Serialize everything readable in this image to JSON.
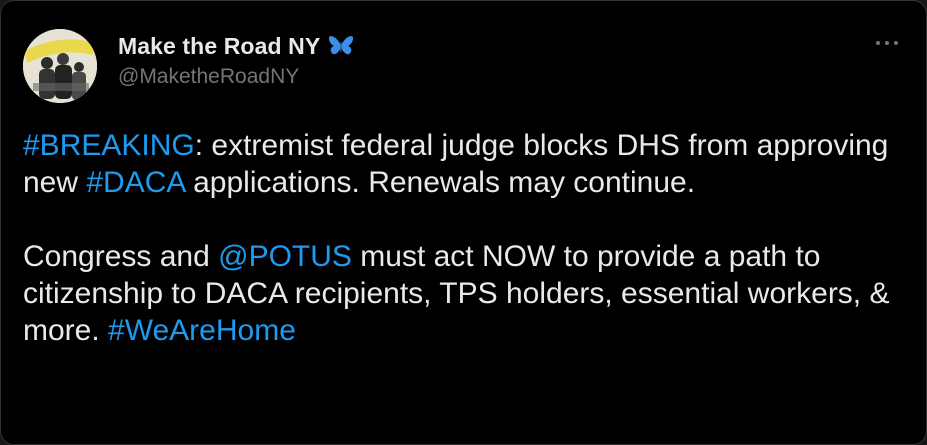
{
  "author": {
    "display_name": "Make the Road NY",
    "badge_icon": "butterfly-icon",
    "handle": "@MaketheRoadNY",
    "avatar_text": "MAKE THE ROAD NEW YORK"
  },
  "menu": {
    "icon": "more-options-icon"
  },
  "tweet": {
    "p1": {
      "hashtag_breaking": "#BREAKING",
      "t1": ": extremist federal judge blocks DHS from approving new ",
      "hashtag_daca": "#DACA",
      "t2": " applications. Renewals may continue."
    },
    "p2": {
      "t1": "Congress and ",
      "mention_potus": "@POTUS",
      "t2": " must act NOW to provide a path to citizenship to DACA recipients, TPS holders, essential workers, & more. ",
      "hashtag_wearehome": "#WeAreHome"
    }
  },
  "colors": {
    "background": "#000000",
    "text": "#e7e9ea",
    "secondary": "#71767b",
    "link": "#1d9bf0",
    "badge": "#3e8ee8"
  }
}
